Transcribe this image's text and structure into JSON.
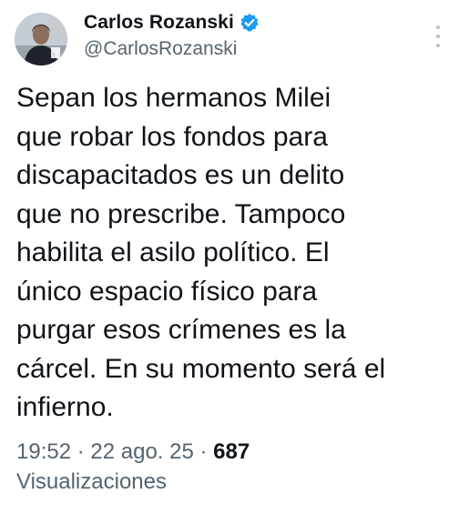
{
  "author": {
    "display_name": "Carlos Rozanski",
    "handle": "@CarlosRozanski",
    "verified_color": "#1d9bf0"
  },
  "icons": {
    "avatar": "avatar-photo",
    "verified": "verified-badge-icon",
    "more": "more-options-icon"
  },
  "tweet": {
    "text": "Sepan los hermanos Milei\nque robar los fondos para\ndiscapacitados es un delito\nque no prescribe. Tampoco\nhabilita el asilo político. El\núnico espacio físico para\npurgar esos crímenes es la\ncárcel. En su momento será el\ninfierno.",
    "time": "19:52",
    "date": "22 ago. 25",
    "separator": " · ",
    "views_count": "687",
    "views_label": "Visualizaciones"
  },
  "colors": {
    "text_primary": "#0f1419",
    "text_secondary": "#536471"
  }
}
